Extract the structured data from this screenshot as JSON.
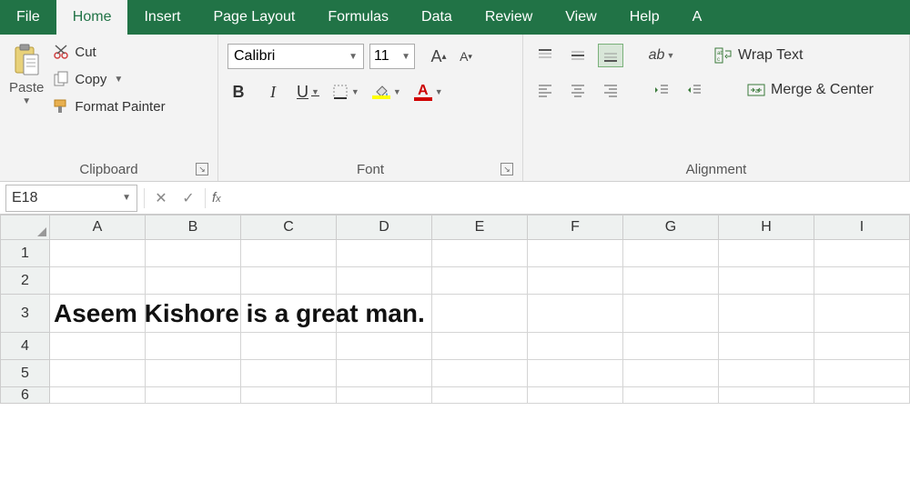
{
  "tabs": {
    "file": "File",
    "home": "Home",
    "insert": "Insert",
    "page_layout": "Page Layout",
    "formulas": "Formulas",
    "data": "Data",
    "review": "Review",
    "view": "View",
    "help": "Help",
    "addins": "A"
  },
  "clipboard": {
    "paste": "Paste",
    "cut": "Cut",
    "copy": "Copy",
    "format_painter": "Format Painter",
    "group_label": "Clipboard"
  },
  "font": {
    "name": "Calibri",
    "size": "11",
    "group_label": "Font"
  },
  "alignment": {
    "wrap_text": "Wrap Text",
    "merge_center": "Merge & Center",
    "group_label": "Alignment"
  },
  "name_box": "E18",
  "formula_value": "",
  "columns": [
    "A",
    "B",
    "C",
    "D",
    "E",
    "F",
    "G",
    "H",
    "I"
  ],
  "rows": [
    "1",
    "2",
    "3",
    "4",
    "5",
    "6"
  ],
  "cell_a3_text": "Aseem Kishore is a great man."
}
